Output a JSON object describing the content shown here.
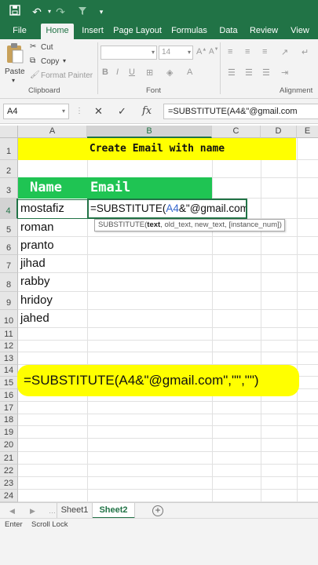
{
  "ribbon": {
    "tabs": [
      "File",
      "Home",
      "Insert",
      "Page Layout",
      "Formulas",
      "Data",
      "Review",
      "View"
    ],
    "paste_label": "Paste",
    "cut_label": "Cut",
    "copy_label": "Copy",
    "format_painter_label": "Format Painter",
    "clipboard_label": "Clipboard",
    "font_size": "14",
    "font_label": "Font",
    "alignment_label": "Alignment"
  },
  "formula_bar": {
    "name_box": "A4",
    "cancel_glyph": "✕",
    "enter_glyph": "✓",
    "fx_glyph": "fx",
    "formula": "=SUBSTITUTE(A4&\"@gmail.com"
  },
  "grid": {
    "columns": [
      "A",
      "B",
      "C",
      "D",
      "E"
    ],
    "rows": [
      "1",
      "2",
      "3",
      "4",
      "5",
      "6",
      "7",
      "8",
      "9",
      "10",
      "11",
      "12",
      "13",
      "14",
      "15",
      "16",
      "17",
      "18",
      "19",
      "20",
      "21",
      "22",
      "23",
      "24"
    ],
    "title": "Create Email with name",
    "header_name": "Name",
    "header_email": "Email",
    "names": [
      "mostafiz",
      "roman",
      "pranto",
      "jihad",
      "rabby",
      "hridoy",
      "jahed"
    ],
    "edit_prefix": "=SUBSTITUTE(",
    "edit_ref": "A4",
    "edit_suffix": "&\"@gmail.com",
    "tooltip_fn": "SUBSTITUTE(",
    "tooltip_arg1": "text",
    "tooltip_rest": ", old_text, new_text, [instance_num])"
  },
  "callout": "=SUBSTITUTE(A4&\"@gmail.com\",\"\",\"\")",
  "sheets": [
    "Sheet1",
    "Sheet2"
  ],
  "active_sheet": "Sheet2",
  "status": {
    "mode": "Enter",
    "scroll_lock": "Scroll Lock"
  },
  "colors": {
    "excel_green": "#217346",
    "title_fill": "#ffff00",
    "header_fill": "#1fc453"
  }
}
